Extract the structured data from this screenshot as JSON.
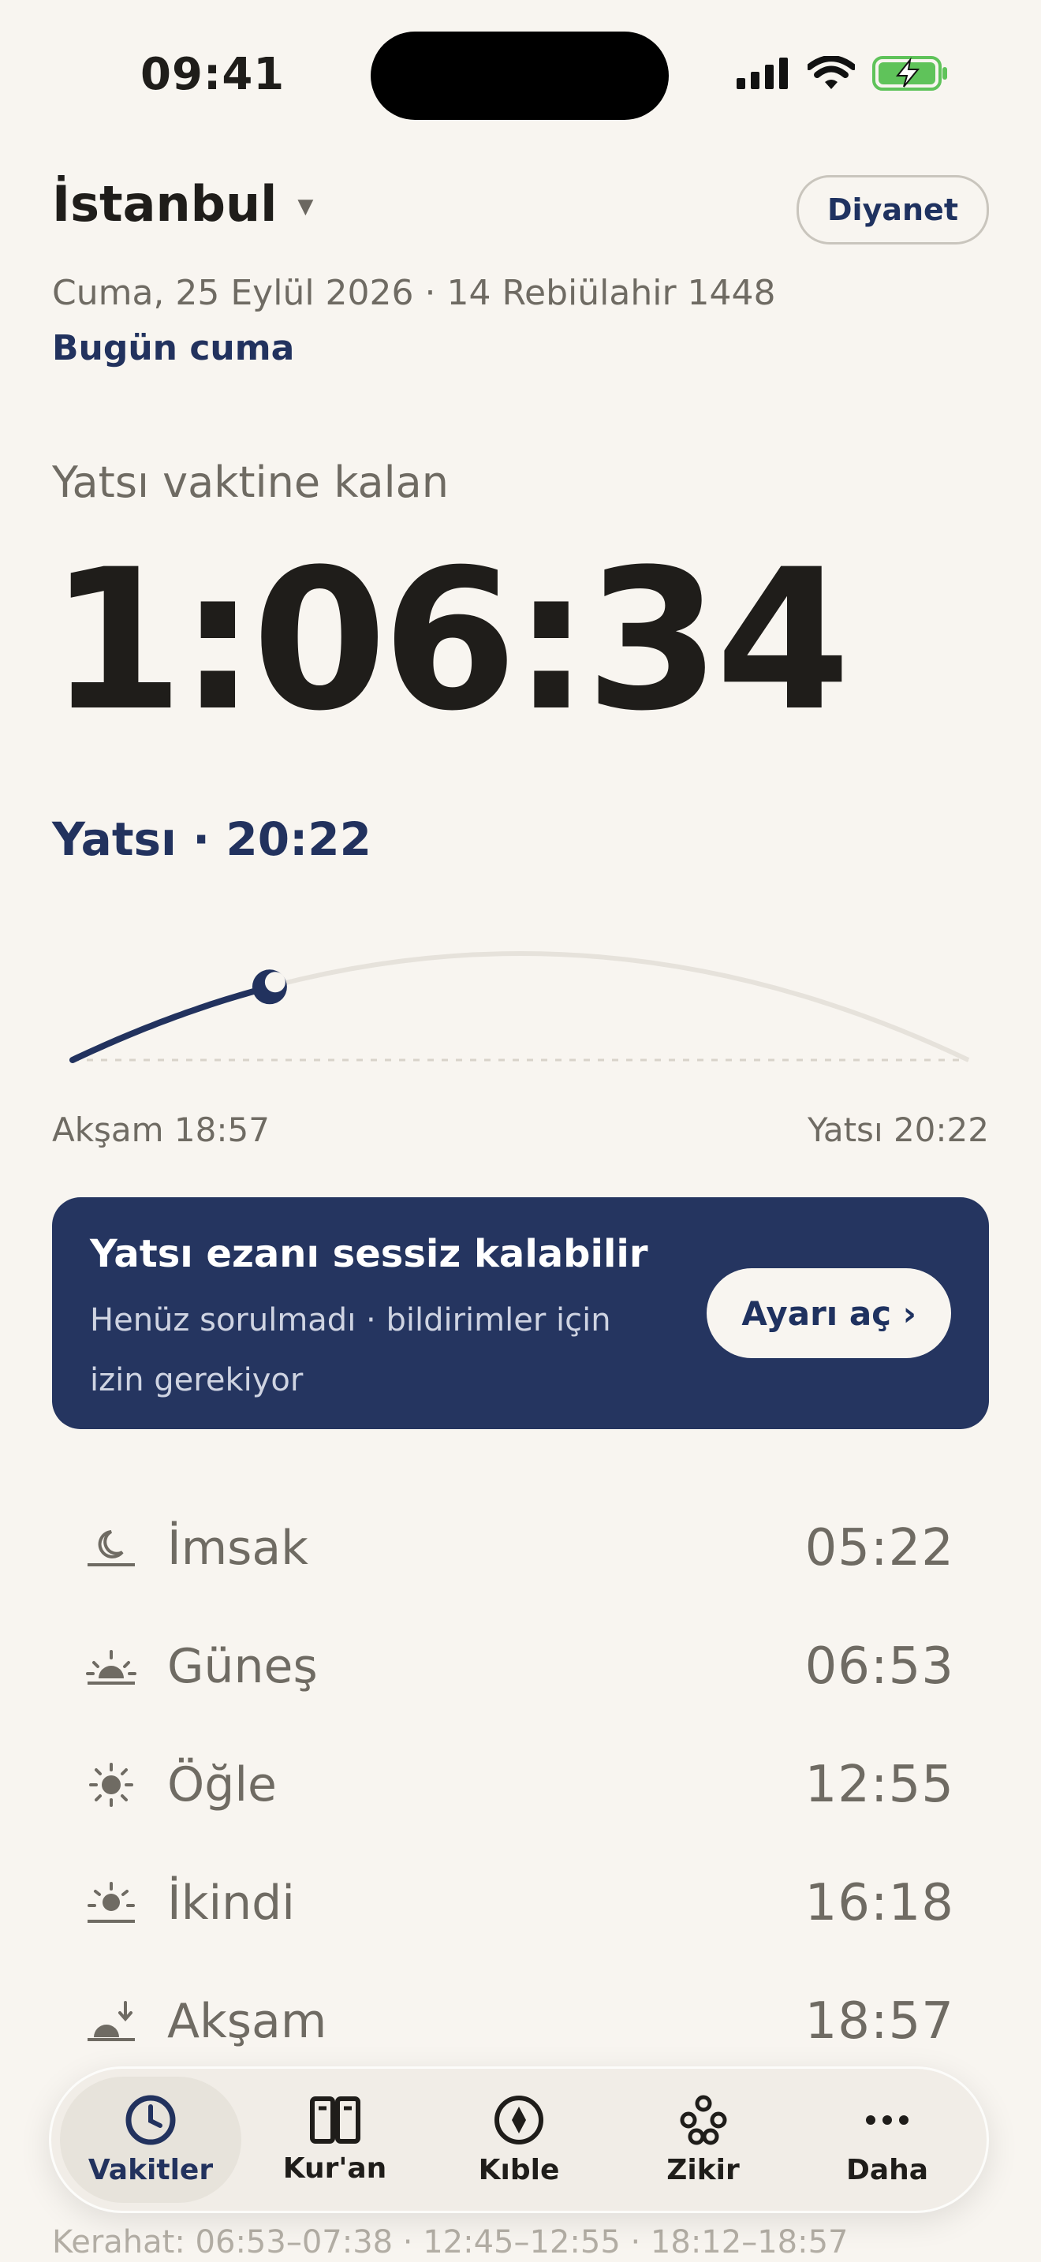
{
  "status_bar": {
    "time": "09:41"
  },
  "header": {
    "city": "İstanbul",
    "source_label": "Diyanet",
    "date": "Cuma, 25 Eylül 2026 · 14 Rebiülahir 1448",
    "friday_note": "Bugün cuma"
  },
  "countdown": {
    "label": "Yatsı vaktine kalan",
    "value": "1:06:34",
    "next": "Yatsı · 20:22",
    "progress_fraction": 0.22,
    "arc_start_label": "Akşam 18:57",
    "arc_end_label": "Yatsı 20:22"
  },
  "banner": {
    "title": "Yatsı ezanı sessiz kalabilir",
    "subtitle": "Henüz sorulmadı · bildirimler için izin gerekiyor",
    "button_label": "Ayarı aç ›"
  },
  "prayers": [
    {
      "name": "İmsak",
      "time": "05:22",
      "icon": "moon-horizon-icon"
    },
    {
      "name": "Güneş",
      "time": "06:53",
      "icon": "sunrise-icon"
    },
    {
      "name": "Öğle",
      "time": "12:55",
      "icon": "sun-icon"
    },
    {
      "name": "İkindi",
      "time": "16:18",
      "icon": "sun-low-icon"
    },
    {
      "name": "Akşam",
      "time": "18:57",
      "icon": "sunset-icon"
    }
  ],
  "kerahat": "Kerahat: 06:53–07:38 · 12:45–12:55 · 18:12–18:57",
  "tabs": [
    {
      "label": "Vakitler",
      "icon": "clock-icon",
      "active": true
    },
    {
      "label": "Kur'an",
      "icon": "book-icon",
      "active": false
    },
    {
      "label": "Kıble",
      "icon": "compass-icon",
      "active": false
    },
    {
      "label": "Zikir",
      "icon": "beads-icon",
      "active": false
    },
    {
      "label": "Daha",
      "icon": "more-icon",
      "active": false
    }
  ],
  "colors": {
    "background": "#f8f5f0",
    "accent": "#253560",
    "text": "#1f1d1a",
    "muted": "#6f6b63"
  }
}
